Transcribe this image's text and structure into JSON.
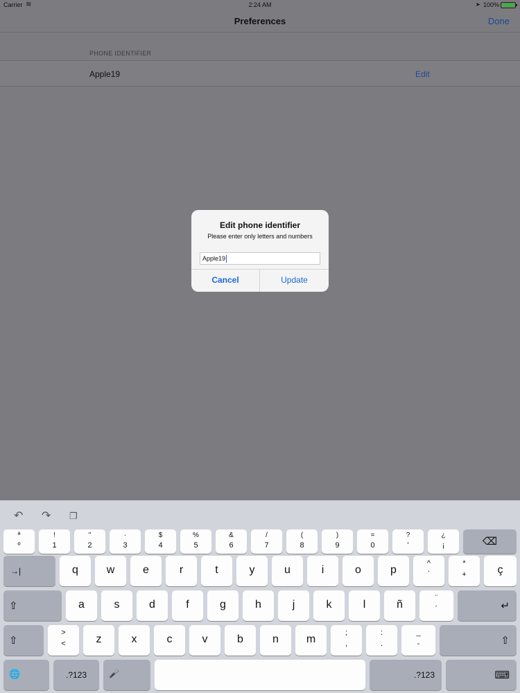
{
  "status": {
    "carrier": "Carrier",
    "time": "2:24 AM",
    "battery": "100%"
  },
  "nav": {
    "title": "Preferences",
    "done": "Done"
  },
  "section": {
    "header": "PHONE IDENTIFIER",
    "value": "Apple19",
    "edit": "Edit"
  },
  "alert": {
    "title": "Edit phone identifier",
    "message": "Please enter only letters and numbers",
    "input_value": "Apple19",
    "cancel": "Cancel",
    "update": "Update"
  },
  "keyboard": {
    "shortcuts": [
      "undo-icon",
      "redo-icon",
      "paste-icon"
    ],
    "row1": [
      {
        "top": "ª",
        "bot": "º"
      },
      {
        "top": "!",
        "bot": "1"
      },
      {
        "top": "\"",
        "bot": "2"
      },
      {
        "top": "·",
        "bot": "3"
      },
      {
        "top": "$",
        "bot": "4"
      },
      {
        "top": "%",
        "bot": "5"
      },
      {
        "top": "&",
        "bot": "6"
      },
      {
        "top": "/",
        "bot": "7"
      },
      {
        "top": "(",
        "bot": "8"
      },
      {
        "top": ")",
        "bot": "9"
      },
      {
        "top": "=",
        "bot": "0"
      },
      {
        "top": "?",
        "bot": "'"
      },
      {
        "top": "¿",
        "bot": "¡"
      }
    ],
    "row2": [
      "q",
      "w",
      "e",
      "r",
      "t",
      "y",
      "u",
      "i",
      "o",
      "p"
    ],
    "row2_extra": [
      {
        "top": "^",
        "bot": "`"
      },
      {
        "top": "*",
        "bot": "+"
      },
      {
        "main": "ç"
      }
    ],
    "row3": [
      "a",
      "s",
      "d",
      "f",
      "g",
      "h",
      "j",
      "k",
      "l",
      "ñ"
    ],
    "row3_extra": {
      "top": "¨",
      "bot": "´"
    },
    "row4_pre": {
      "top": ">",
      "bot": "<"
    },
    "row4": [
      "z",
      "x",
      "c",
      "v",
      "b",
      "n",
      "m"
    ],
    "row4_extra": [
      {
        "top": ";",
        "bot": ","
      },
      {
        "top": ":",
        "bot": "."
      },
      {
        "top": "_",
        "bot": "-"
      }
    ],
    "numbers_label": ".?123",
    "icons": {
      "tab": "→|",
      "shift": "⇧",
      "delete": "⌫",
      "return": "↵",
      "globe": "🌐",
      "mic": "🎤",
      "hide": "⌨"
    }
  }
}
